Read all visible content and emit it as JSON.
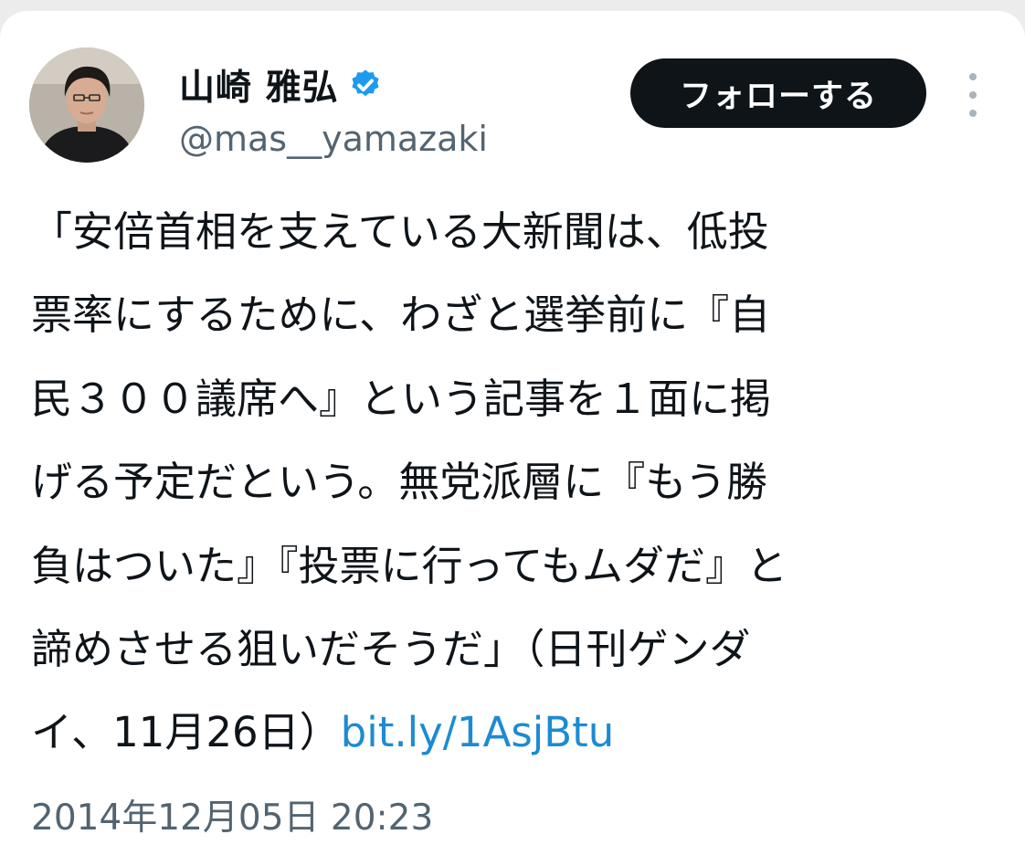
{
  "author": {
    "display_name": "山崎 雅弘",
    "handle": "@mas__yamazaki",
    "verified": true,
    "avatar": "portrait-photo"
  },
  "actions": {
    "follow_label": "フォローする",
    "more_icon": "more-vertical-icon"
  },
  "tweet": {
    "lines": [
      "「安倍首相を支えている大新聞は、低投",
      "票率にするために、わざと選挙前に『自",
      "民３００議席へ』という記事を１面に掲",
      "げる予定だという。無党派層に『もう勝",
      "負はついた』『投票に行ってもムダだ』と",
      "諦めさせる狙いだそうだ」（日刊ゲンダ"
    ],
    "last_line_text": "イ、11月26日）",
    "link_text": "bit.ly/1AsjBtu"
  },
  "timestamp": "2014年12月05日 20:23",
  "colors": {
    "link": "#1d8bd1",
    "verified_badge": "#1d9bf0",
    "follow_button_bg": "#0f1419",
    "secondary_text": "#536471"
  }
}
